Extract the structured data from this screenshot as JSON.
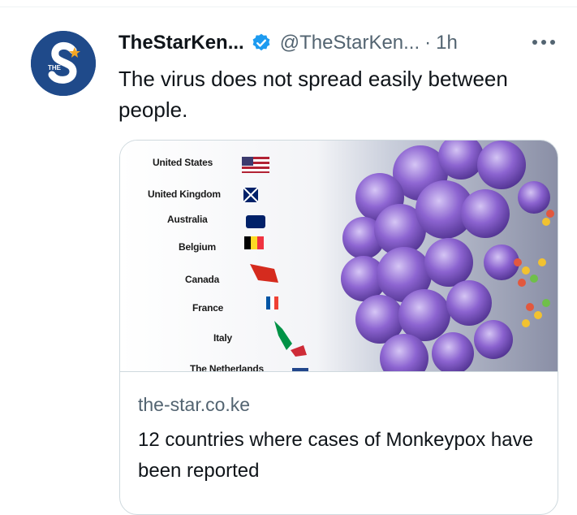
{
  "tweet": {
    "author_name": "TheStarKen...",
    "author_handle": "@TheStarKen...",
    "separator": "·",
    "time": "1h",
    "text": "The virus does not spread easily between people.",
    "avatar_letters": "THE S"
  },
  "card": {
    "domain": "the-star.co.ke",
    "title": "12 countries where cases of Monkeypox have been reported",
    "countries": [
      "United States",
      "United Kingdom",
      "Australia",
      "Belgium",
      "Canada",
      "France",
      "Italy",
      "The Netherlands"
    ]
  },
  "icons": {
    "verified": "verified-badge-icon",
    "more": "more-options-icon"
  },
  "colors": {
    "verified": "#1d9bf0",
    "secondary_text": "#536471",
    "border": "#cfd9de",
    "avatar_bg": "#1f4a8a",
    "virus_purple": "#6a3fb0"
  }
}
